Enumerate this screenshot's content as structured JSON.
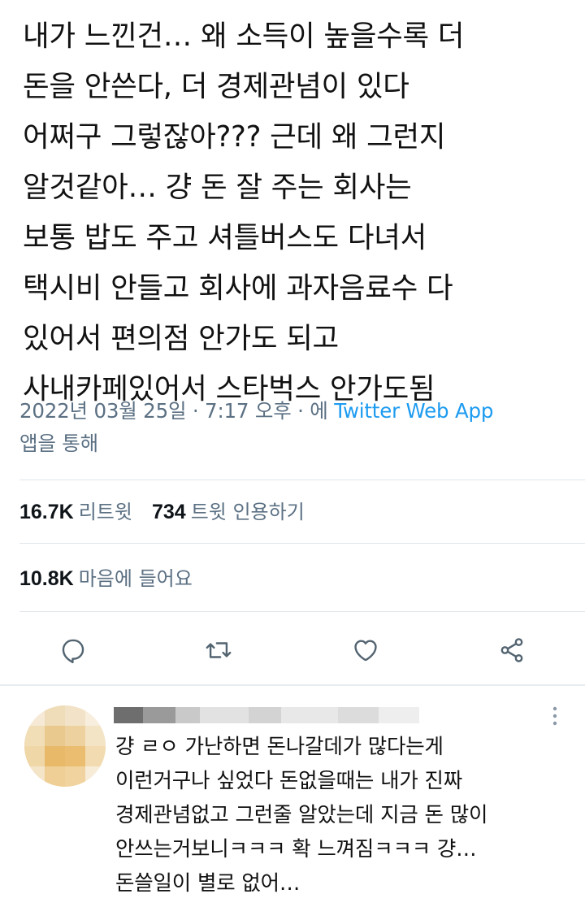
{
  "tweet": {
    "lines": [
      "내가 느낀건… 왜 소득이 높을수록 더",
      "돈을 안쓴다, 더 경제관념이 있다",
      "어쩌구 그렇잖아??? 근데 왜 그런지",
      "알것같아… 걍 돈 잘 주는 회사는",
      "보통 밥도 주고 셔틀버스도 다녀서",
      "택시비 안들고 회사에 과자음료수 다",
      "있어서 편의점 안가도 되고",
      "사내카페있어서 스타벅스 안가도됨"
    ]
  },
  "meta": {
    "datetime": "2022년 03월 25일 · 7:17 오후 · 에 ",
    "via": "Twitter Web App",
    "via_suffix": "앱을 통해"
  },
  "stats": {
    "retweets_count": "16.7K",
    "retweets_label": "리트윗",
    "quotes_count": "734",
    "quotes_label": "트윗 인용하기",
    "likes_count": "10.8K",
    "likes_label": "마음에 들어요"
  },
  "actions": [
    {
      "name": "reply",
      "icon": "comment-icon"
    },
    {
      "name": "retweet",
      "icon": "retweet-icon"
    },
    {
      "name": "like",
      "icon": "heart-icon"
    },
    {
      "name": "share",
      "icon": "share-icon"
    }
  ],
  "reply": {
    "avatar": "blurred-avatar",
    "header": "blurred-user-name",
    "lines": [
      "걍 ㄹㅇ 가난하면 돈나갈데가 많다는게",
      "이런거구나 싶었다 돈없을때는 내가 진짜",
      "경제관념없고 그런줄 알았는데 지금 돈 많이",
      "안쓰는거보니ㅋㅋㅋ 확 느껴짐ㅋㅋㅋ 걍…",
      "돈쓸일이 별로 없어…"
    ]
  },
  "colors": {
    "text": "#111111",
    "secondary": "#5b7083",
    "link": "#1d9bf0",
    "divider": "#e1e6ea",
    "icon": "#536471"
  }
}
